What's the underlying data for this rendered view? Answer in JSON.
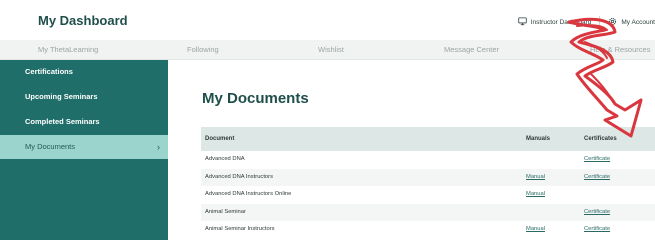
{
  "header": {
    "title": "My Dashboard",
    "actions": [
      {
        "label": "Instructor Dashboard",
        "icon": "monitor-icon"
      },
      {
        "label": "My Account",
        "icon": "gear-icon"
      }
    ]
  },
  "nav": {
    "items": [
      {
        "label": "My ThetaLearning"
      },
      {
        "label": "Following"
      },
      {
        "label": "Wishlist"
      },
      {
        "label": "Message Center"
      },
      {
        "label": "Help & Resources"
      }
    ]
  },
  "sidebar": {
    "items": [
      {
        "label": "Certifications"
      },
      {
        "label": "Upcoming Seminars"
      },
      {
        "label": "Completed Seminars"
      },
      {
        "label": "My Documents",
        "active": true
      }
    ],
    "chevron": "›"
  },
  "main": {
    "title": "My Documents",
    "table": {
      "headers": {
        "document": "Document",
        "manuals": "Manuals",
        "certificates": "Certificates"
      },
      "rows": [
        {
          "document": "Advanced DNA",
          "manual": "",
          "certificate": "Certificate"
        },
        {
          "document": "Advanced DNA Instructors",
          "manual": "Manual",
          "certificate": "Certificate"
        },
        {
          "document": "Advanced DNA Instructors Online",
          "manual": "Manual",
          "certificate": ""
        },
        {
          "document": "Animal Seminar",
          "manual": "",
          "certificate": "Certificate"
        },
        {
          "document": "Animal Seminar Instructors",
          "manual": "Manual",
          "certificate": "Certificate"
        }
      ]
    }
  },
  "colors": {
    "sidebar_bg": "#1f6e69",
    "sidebar_active_bg": "#9bd3cd",
    "accent_text": "#1f4f4a",
    "annotation_arrow": "#d9363e"
  }
}
